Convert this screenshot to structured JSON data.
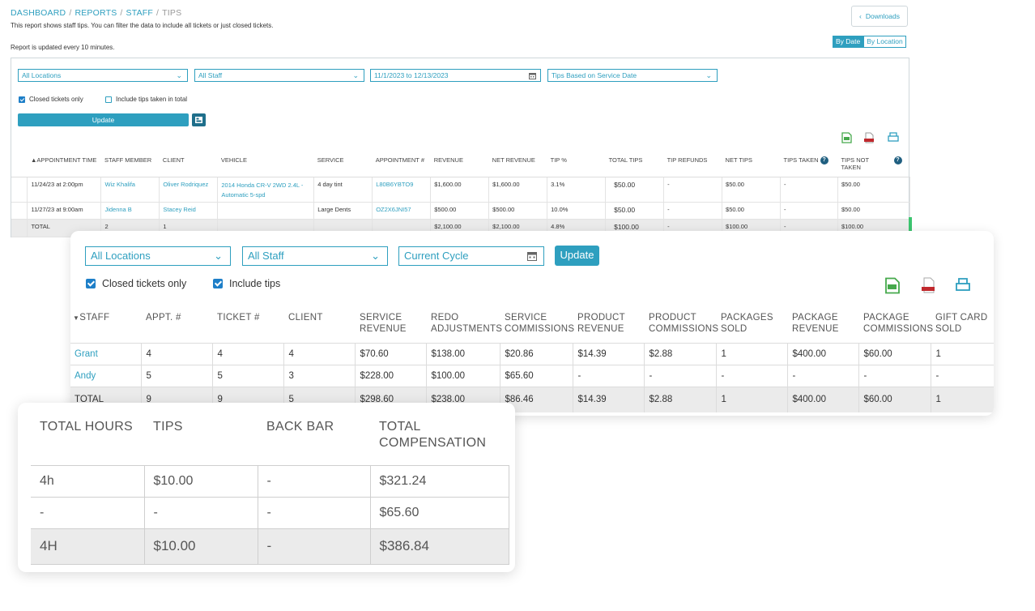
{
  "breadcrumb": [
    "DASHBOARD",
    "REPORTS",
    "STAFF",
    "TIPS"
  ],
  "description": "This report shows staff tips. You can filter the data to include all tickets or just closed tickets.",
  "update_note": "Report is updated every 10 minutes.",
  "downloads_label": "Downloads",
  "view_toggle": {
    "by_date": "By Date",
    "by_location": "By Location",
    "active": "By Date"
  },
  "filters1": {
    "location": "All Locations",
    "staff": "All Staff",
    "date_range": "11/1/2023 to 12/13/2023",
    "tips_basis": "Tips Based on Service Date",
    "closed_only": "Closed tickets only",
    "include_tips_total": "Include tips taken in total",
    "update": "Update"
  },
  "table1": {
    "headers": [
      "APPOINTMENT TIME",
      "STAFF MEMBER",
      "CLIENT",
      "VEHICLE",
      "SERVICE",
      "APPOINTMENT #",
      "REVENUE",
      "NET REVENUE",
      "TIP %",
      "TOTAL TIPS",
      "TIP REFUNDS",
      "NET TIPS",
      "TIPS TAKEN",
      "TIPS NOT TAKEN"
    ],
    "rows": [
      [
        "11/24/23 at 2:00pm",
        "Wiz Khalifa",
        "Oliver Rodriquez",
        "2014 Honda CR-V 2WD 2.4L - Automatic 5-spd",
        "4 day tint",
        "L80B6YBTO9",
        "$1,600.00",
        "$1,600.00",
        "3.1%",
        "$50.00",
        "-",
        "$50.00",
        "-",
        "$50.00"
      ],
      [
        "11/27/23 at 9:00am",
        "Jidenna B",
        "Stacey Reid",
        "",
        "Large Dents",
        "OZ2X6JNI57",
        "$500.00",
        "$500.00",
        "10.0%",
        "$50.00",
        "-",
        "$50.00",
        "-",
        "$50.00"
      ]
    ],
    "total": [
      "TOTAL",
      "2",
      "1",
      "",
      "",
      "",
      "$2,100.00",
      "$2,100.00",
      "4.8%",
      "$100.00",
      "-",
      "$100.00",
      "-",
      "$100.00"
    ]
  },
  "filters2": {
    "location": "All Locations",
    "staff": "All Staff",
    "cycle": "Current Cycle",
    "update": "Update",
    "closed_only": "Closed tickets only",
    "include_tips": "Include tips"
  },
  "table2": {
    "headers": [
      "STAFF",
      "APPT. #",
      "TICKET #",
      "CLIENT",
      "SERVICE REVENUE",
      "REDO ADJUSTMENTS",
      "SERVICE COMMISSIONS",
      "PRODUCT REVENUE",
      "PRODUCT COMMISSIONS",
      "PACKAGES SOLD",
      "PACKAGE REVENUE",
      "PACKAGE COMMISSIONS",
      "GIFT CARD SOLD"
    ],
    "rows": [
      [
        "Grant",
        "4",
        "4",
        "4",
        "$70.60",
        "$138.00",
        "$20.86",
        "$14.39",
        "$2.88",
        "1",
        "$400.00",
        "$60.00",
        "1"
      ],
      [
        "Andy",
        "5",
        "5",
        "3",
        "$228.00",
        "$100.00",
        "$65.60",
        "-",
        "-",
        "-",
        "-",
        "-",
        "-"
      ]
    ],
    "total": [
      "TOTAL",
      "9",
      "9",
      "5",
      "$298.60",
      "$238.00",
      "$86.46",
      "$14.39",
      "$2.88",
      "1",
      "$400.00",
      "$60.00",
      "1"
    ]
  },
  "table3": {
    "headers": [
      "TOTAL HOURS",
      "TIPS",
      "BACK BAR",
      "TOTAL COMPENSATION"
    ],
    "rows": [
      [
        "4h",
        "$10.00",
        "-",
        "$321.24"
      ],
      [
        "-",
        "-",
        "-",
        "$65.60"
      ]
    ],
    "total": [
      "4H",
      "$10.00",
      "-",
      "$386.84"
    ]
  },
  "colors": {
    "accent": "#2e9fbf",
    "check": "#1e7fc8",
    "csv": "#46a94c",
    "pdf": "#c0282d",
    "total_row": "#ebebeb"
  }
}
